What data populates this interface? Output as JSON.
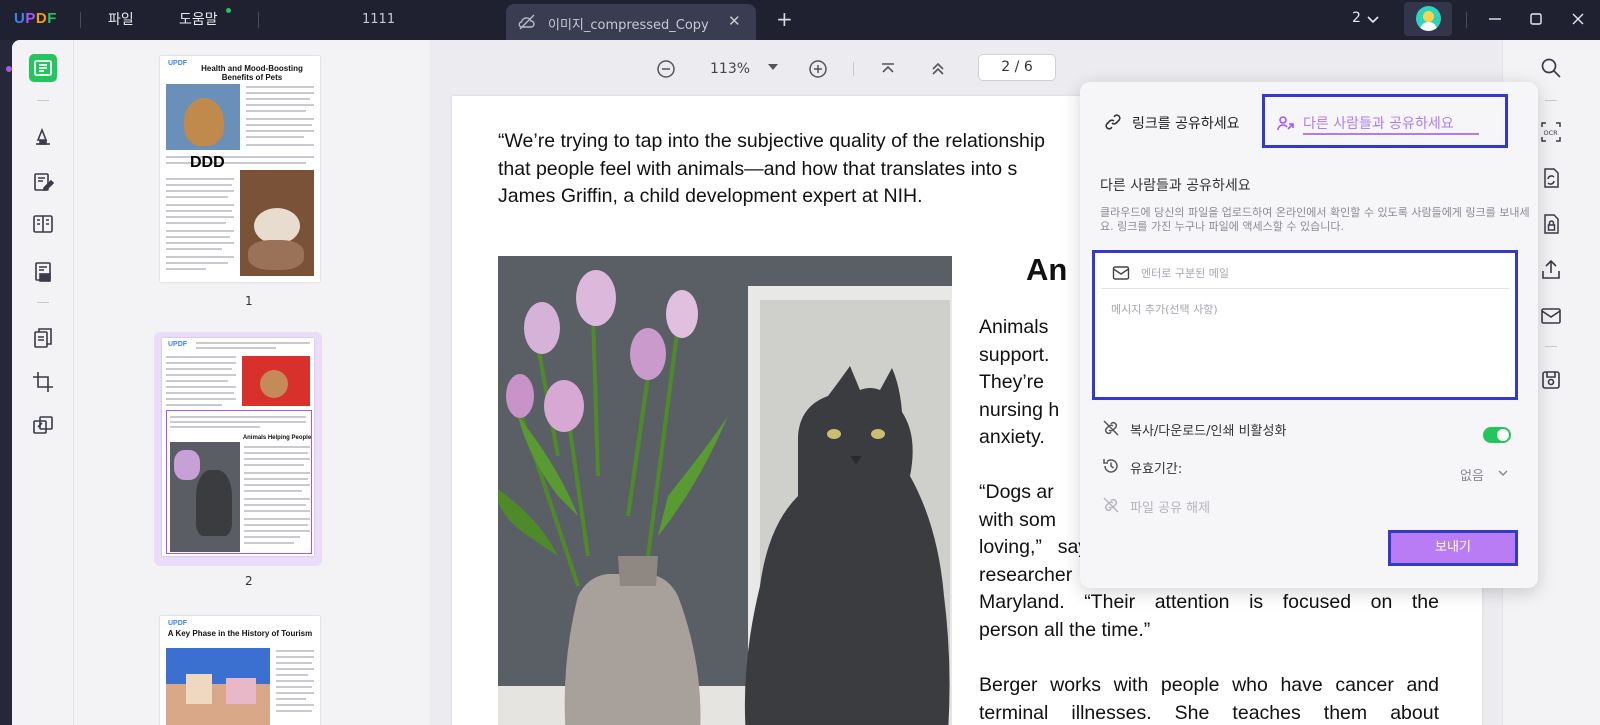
{
  "titlebar": {
    "logo": "UPDF",
    "menu_file": "파일",
    "menu_help": "도움말",
    "extra_tab": "1111",
    "tab_title": "이미지_compressed_Copy",
    "tab_close": "✕",
    "new_tab": "+",
    "tab_count": "2"
  },
  "thumbnails": [
    {
      "number": "1",
      "title": "Health and Mood-Boosting Benefits of Pets",
      "logo": "UPDF",
      "overlay_text": "DDD",
      "selected": false
    },
    {
      "number": "2",
      "title": "Animals Helping People",
      "logo": "UPDF",
      "selected": true
    },
    {
      "number": "",
      "title": "A Key Phase in the History of Tourism",
      "logo": "UPDF",
      "selected": false
    }
  ],
  "doc_toolbar": {
    "zoom": "113%",
    "current_page": "2",
    "page_separator": "/",
    "total_pages": "6"
  },
  "page_content": {
    "quote_lines": [
      "“We’re trying to tap into the subjective quality of the relationship",
      "that people feel with animals—and how that translates into s",
      "James Griffin, a child development expert at NIH."
    ],
    "section_title": "An",
    "para1_lines": [
      "Animals",
      "support.",
      "They’re",
      "nursing h",
      "anxiety."
    ],
    "para2_lines": [
      "“Dogs ar",
      "with som",
      "loving,” says Dr. Ann Berger, a physician and",
      "researcher at the NIH Clinical Center in Bethesda,",
      "Maryland. “Their attention is focused on the",
      "person all the time.”"
    ],
    "para3_lines": [
      "Berger works with people who have cancer and",
      "terminal illnesses. She teaches them about"
    ]
  },
  "share_panel": {
    "tab_link": "링크를 공유하세요",
    "tab_people": "다른 사람들과 공유하세요",
    "heading": "다른 사람들과 공유하세요",
    "description": "클라우드에 당신의 파일을 업로드하여 온라인에서 확인할 수 있도록 사람들에게 링크를 보내세요. 링크를 가진 누구나 파일에 액세스할 수 있습니다.",
    "email_placeholder": "엔터로 구분된 메일",
    "message_placeholder": "메시지 추가(선택 사항)",
    "disable_copy_label": "복사/다운로드/인쇄 비활성화",
    "disable_copy_enabled": true,
    "expiry_label": "유효기간:",
    "expiry_value": "없음",
    "unshare_label": "파일 공유 해제",
    "send_button": "보내기"
  },
  "colors": {
    "accent_purple": "#b97cf5",
    "highlight_blue": "#3339c8",
    "toggle_green": "#22c55e",
    "titlebar_bg": "#1f2130"
  },
  "icons": {
    "left_toolbar": [
      "reader-icon",
      "comment-icon",
      "edit-icon",
      "organize-icon",
      "form-icon",
      "pages-icon",
      "crop-icon",
      "layers-icon"
    ],
    "right_toolbar": [
      "search-icon",
      "ocr-icon",
      "convert-icon",
      "protect-icon",
      "share-icon",
      "email-icon",
      "save-icon"
    ]
  }
}
